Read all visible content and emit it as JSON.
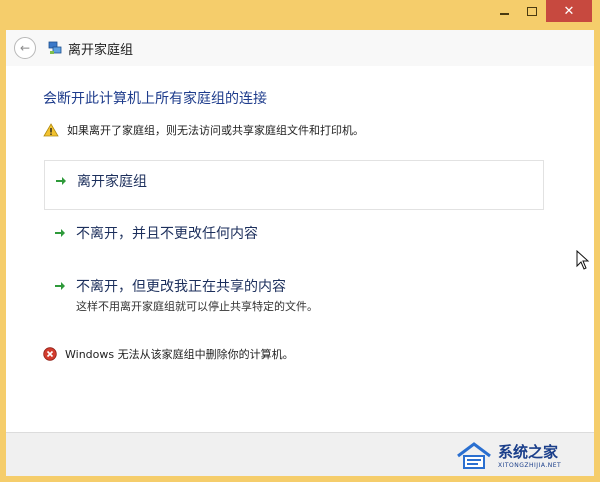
{
  "window": {
    "caption_buttons": [
      "minimize",
      "maximize",
      "close"
    ],
    "close_glyph": "✕"
  },
  "nav": {
    "back_glyph": "←",
    "title": "离开家庭组"
  },
  "main": {
    "heading": "会断开此计算机上所有家庭组的连接",
    "warning": "如果离开了家庭组，则无法访问或共享家庭组文件和打印机。",
    "options": [
      {
        "label": "离开家庭组",
        "description": ""
      },
      {
        "label": "不离开，并且不更改任何内容",
        "description": ""
      },
      {
        "label": "不离开，但更改我正在共享的内容",
        "description": "这样不用离开家庭组就可以停止共享特定的文件。"
      }
    ],
    "error": "Windows 无法从该家庭组中删除你的计算机。"
  },
  "watermark": {
    "main": "系统之家",
    "sub": "XITONGZHIJIA.NET"
  },
  "colors": {
    "frame": "#f5cd6b",
    "heading": "#1e3c8c",
    "arrow": "#2e9a3a",
    "close": "#c7493f"
  }
}
